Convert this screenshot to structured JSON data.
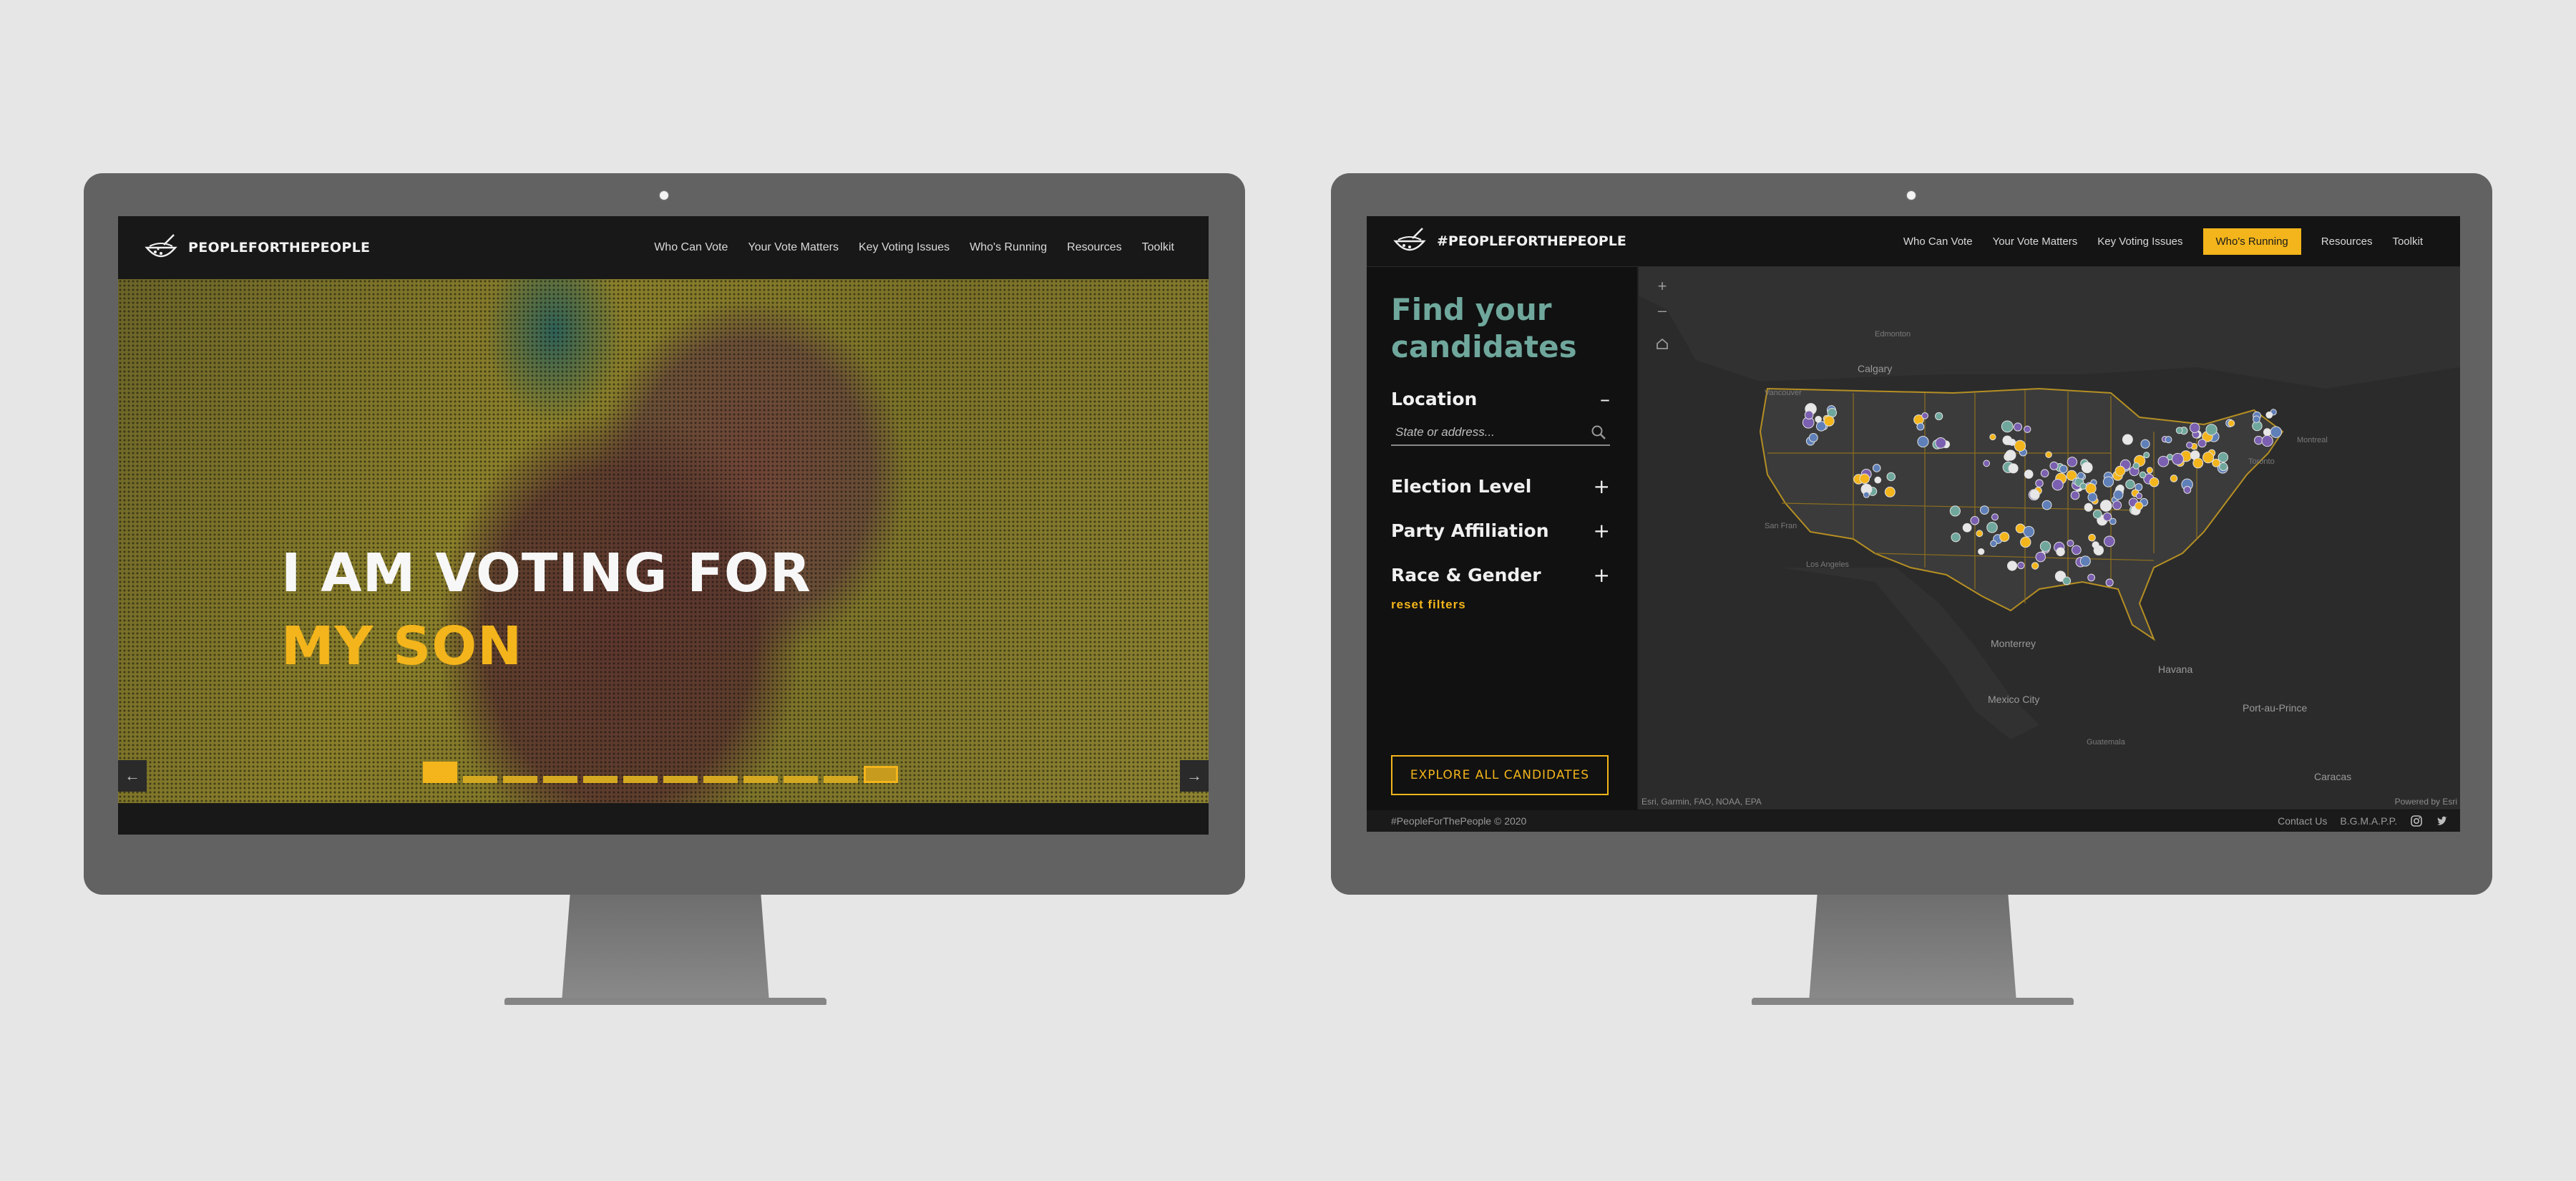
{
  "left_site": {
    "brand": "PEOPLEFORTHEPEOPLE",
    "nav": [
      "Who Can Vote",
      "Your Vote Matters",
      "Key Voting Issues",
      "Who's Running",
      "Resources",
      "Toolkit"
    ],
    "hero": {
      "line1": "I AM VOTING FOR",
      "line2": "MY SON"
    },
    "prev_arrow": "←",
    "next_arrow": "→",
    "slide_count": 12,
    "active_slide": 1
  },
  "right_site": {
    "brand": "#PEOPLEFORTHEPEOPLE",
    "nav": [
      "Who Can Vote",
      "Your Vote Matters",
      "Key Voting Issues",
      "Who's Running",
      "Resources",
      "Toolkit"
    ],
    "active_nav": "Who's Running",
    "panel": {
      "title_line1": "Find your",
      "title_line2": "candidates",
      "filters": [
        {
          "label": "Location",
          "sign": "–"
        },
        {
          "label": "Election Level",
          "sign": "+"
        },
        {
          "label": "Party Affiliation",
          "sign": "+"
        },
        {
          "label": "Race & Gender",
          "sign": "+"
        }
      ],
      "search_placeholder": "State or address...",
      "reset": "reset filters",
      "explore": "EXPLORE ALL CANDIDATES"
    },
    "map": {
      "zoom_in": "+",
      "zoom_out": "–",
      "labels": {
        "edmonton": "Edmonton",
        "calgary": "Calgary",
        "vancouver": "Vancouver",
        "san_francisco": "San Fran",
        "los_angeles": "Los Angeles",
        "montreal": "Montreal",
        "toronto": "Toronto",
        "monterrey": "Monterrey",
        "havana": "Havana",
        "mexico_city": "Mexico City",
        "port_au_prince": "Port-au-Prince",
        "guatemala": "Guatemala",
        "caracas": "Caracas"
      },
      "attribution_left": "Esri, Garmin, FAO, NOAA, EPA",
      "attribution_right": "Powered by Esri"
    },
    "footer": {
      "copyright": "#PeopleForThePeople © 2020",
      "contact": "Contact Us",
      "credit": "B.G.M.A.P.P."
    }
  },
  "colors": {
    "accent": "#f3b51b",
    "teal": "#6fa79c",
    "bezel": "#626262",
    "background": "#e6e6e6"
  }
}
